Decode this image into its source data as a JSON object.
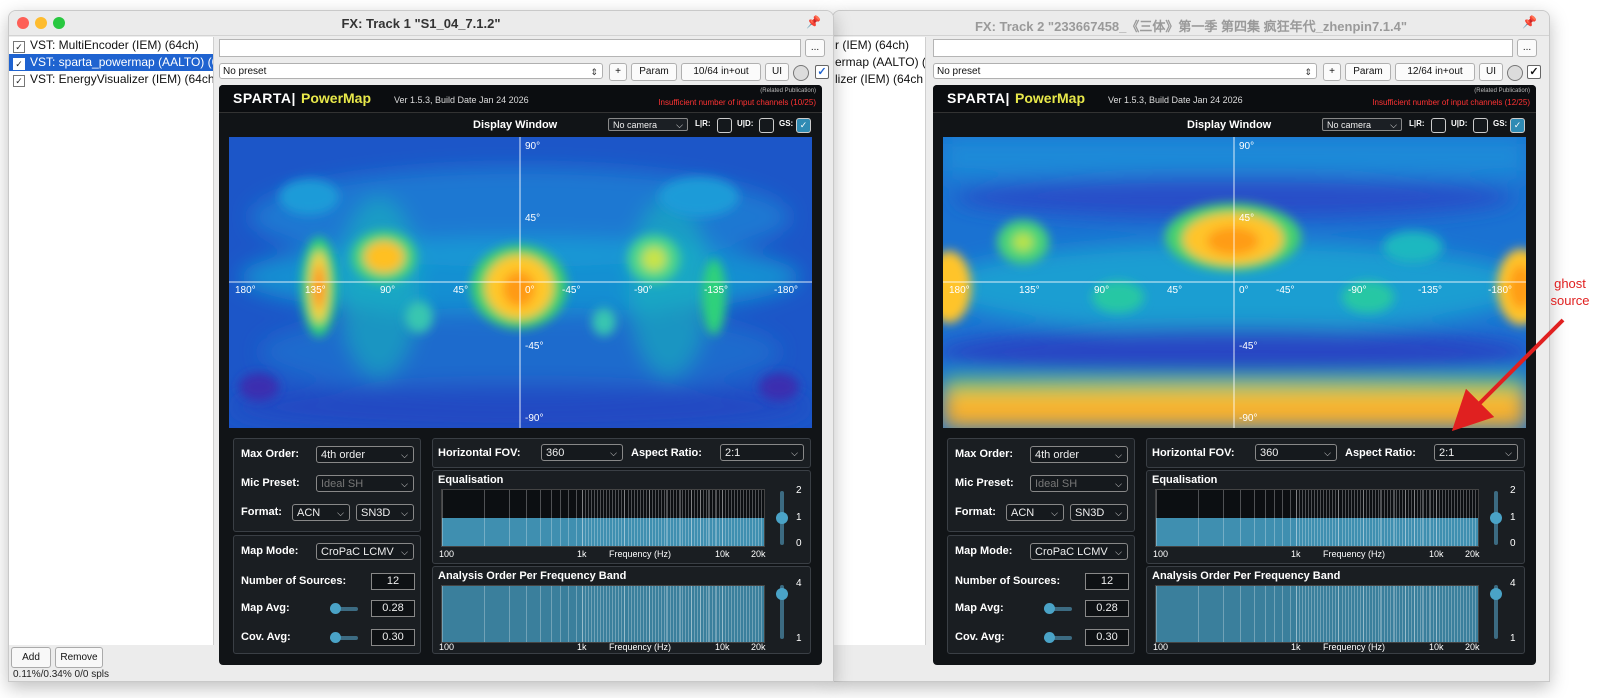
{
  "windows": [
    {
      "id": "win1",
      "title": "FX: Track 1 \"S1_04_7.1.2\"",
      "fx_items": [
        {
          "label": "VST: MultiEncoder (IEM) (64ch)",
          "checked": true,
          "selected": false
        },
        {
          "label": "VST: sparta_powermap (AALTO) (6",
          "checked": true,
          "selected": true
        },
        {
          "label": "VST: EnergyVisualizer (IEM) (64ch",
          "checked": true,
          "selected": false
        }
      ],
      "buttons": {
        "add": "Add",
        "remove": "Remove"
      },
      "cpu": "0.11%/0.34% 0/0 spls",
      "preset": "No preset",
      "io": "10/64 in+out",
      "warning": "Insufficient number of input channels (10/25)"
    },
    {
      "id": "win2",
      "title": "FX: Track 2 \"233667458_《三体》第一季 第四集 疯狂年代_zhenpin7.1.4\"",
      "fx_items": [
        {
          "label": "r (IEM) (64ch)"
        },
        {
          "label": "ermap (AALTO) (6"
        },
        {
          "label": "lizer (IEM) (64ch"
        }
      ],
      "preset": "No preset",
      "io": "12/64 in+out",
      "warning": "Insufficient number of input channels (12/25)"
    }
  ],
  "toolbar": {
    "more": "...",
    "plus": "+",
    "param": "Param",
    "ui": "UI"
  },
  "plugin": {
    "brand": "SPARTA|",
    "name": "PowerMap",
    "version": "Ver 1.5.3, Build Date Jan 24 2026",
    "related": "(Related Publication)",
    "display_window": "Display Window",
    "camera": "No camera",
    "lr": "L|R:",
    "ud": "U|D:",
    "gs": "GS:",
    "lat_labels": [
      "90°",
      "45°",
      "-45°",
      "-90°"
    ],
    "lon_labels": [
      "180°",
      "135°",
      "90°",
      "45°",
      "0°",
      "-45°",
      "-90°",
      "-135°",
      "-180°"
    ],
    "max_order_label": "Max Order:",
    "max_order": "4th order",
    "mic_preset_label": "Mic Preset:",
    "mic_preset": "Ideal SH",
    "format_label": "Format:",
    "format_a": "ACN",
    "format_b": "SN3D",
    "hfov_label": "Horizontal FOV:",
    "hfov": "360",
    "aspect_label": "Aspect Ratio:",
    "aspect": "2:1",
    "equalisation": "Equalisation",
    "eq_ticks": [
      "2",
      "1",
      "0"
    ],
    "freq_ticks": [
      "100",
      "1k",
      "10k",
      "20k"
    ],
    "freq_axis": "Frequency (Hz)",
    "map_mode_label": "Map Mode:",
    "map_mode": "CroPaC LCMV",
    "num_sources_label": "Number of Sources:",
    "num_sources": "12",
    "map_avg_label": "Map Avg:",
    "map_avg": "0.28",
    "cov_avg_label": "Cov. Avg:",
    "cov_avg": "0.30",
    "analysis_order": "Analysis Order Per Frequency Band",
    "ao_ticks": [
      "4",
      "1"
    ]
  },
  "annotation": {
    "line1": "ghost",
    "line2": "source",
    "color": "#e02020"
  }
}
